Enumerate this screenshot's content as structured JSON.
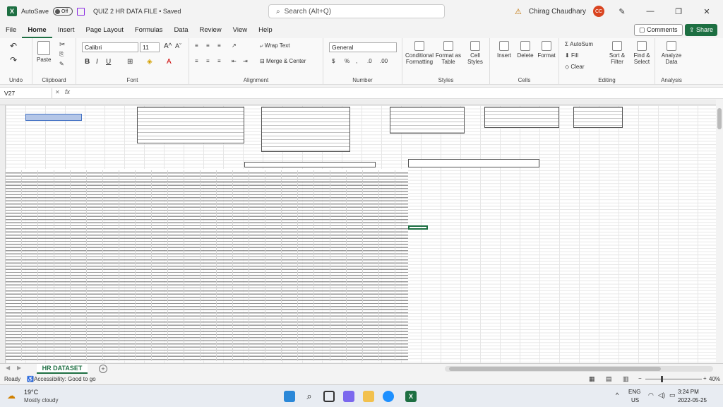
{
  "titlebar": {
    "autosave_label": "AutoSave",
    "autosave_state": "Off",
    "doc_title": "QUIZ 2 HR DATA FILE • Saved",
    "search_placeholder": "Search (Alt+Q)",
    "user_name": "Chirag Chaudhary",
    "user_initials": "CC"
  },
  "menu": {
    "items": [
      "File",
      "Home",
      "Insert",
      "Page Layout",
      "Formulas",
      "Data",
      "Review",
      "View",
      "Help"
    ],
    "active": "Home",
    "comments_label": "Comments",
    "share_label": "Share"
  },
  "ribbon": {
    "font_name": "Calibri",
    "font_size": "11",
    "number_format": "General",
    "paste_label": "Paste",
    "wrap_text": "Wrap Text",
    "merge_center": "Merge & Center",
    "conditional_formatting": "Conditional Formatting",
    "format_as_table": "Format as Table",
    "cell_styles": "Cell Styles",
    "insert": "Insert",
    "delete": "Delete",
    "format": "Format",
    "autosum": "AutoSum",
    "fill": "Fill",
    "clear": "Clear",
    "sort_filter": "Sort & Filter",
    "find_select": "Find & Select",
    "analyze_data": "Analyze Data",
    "groups": {
      "undo": "Undo",
      "clipboard": "Clipboard",
      "font": "Font",
      "alignment": "Alignment",
      "number": "Number",
      "styles": "Styles",
      "cells": "Cells",
      "editing": "Editing",
      "analysis": "Analysis"
    }
  },
  "formula_bar": {
    "name_box": "V27",
    "fx": "fx"
  },
  "sheet": {
    "tab_name": "HR DATASET"
  },
  "status": {
    "ready": "Ready",
    "accessibility": "Accessibility: Good to go",
    "zoom": "40%"
  },
  "taskbar": {
    "temp": "19°C",
    "weather": "Mostly cloudy",
    "lang": "ENG",
    "region": "US",
    "time": "3:24 PM",
    "date": "2022-05-25"
  }
}
